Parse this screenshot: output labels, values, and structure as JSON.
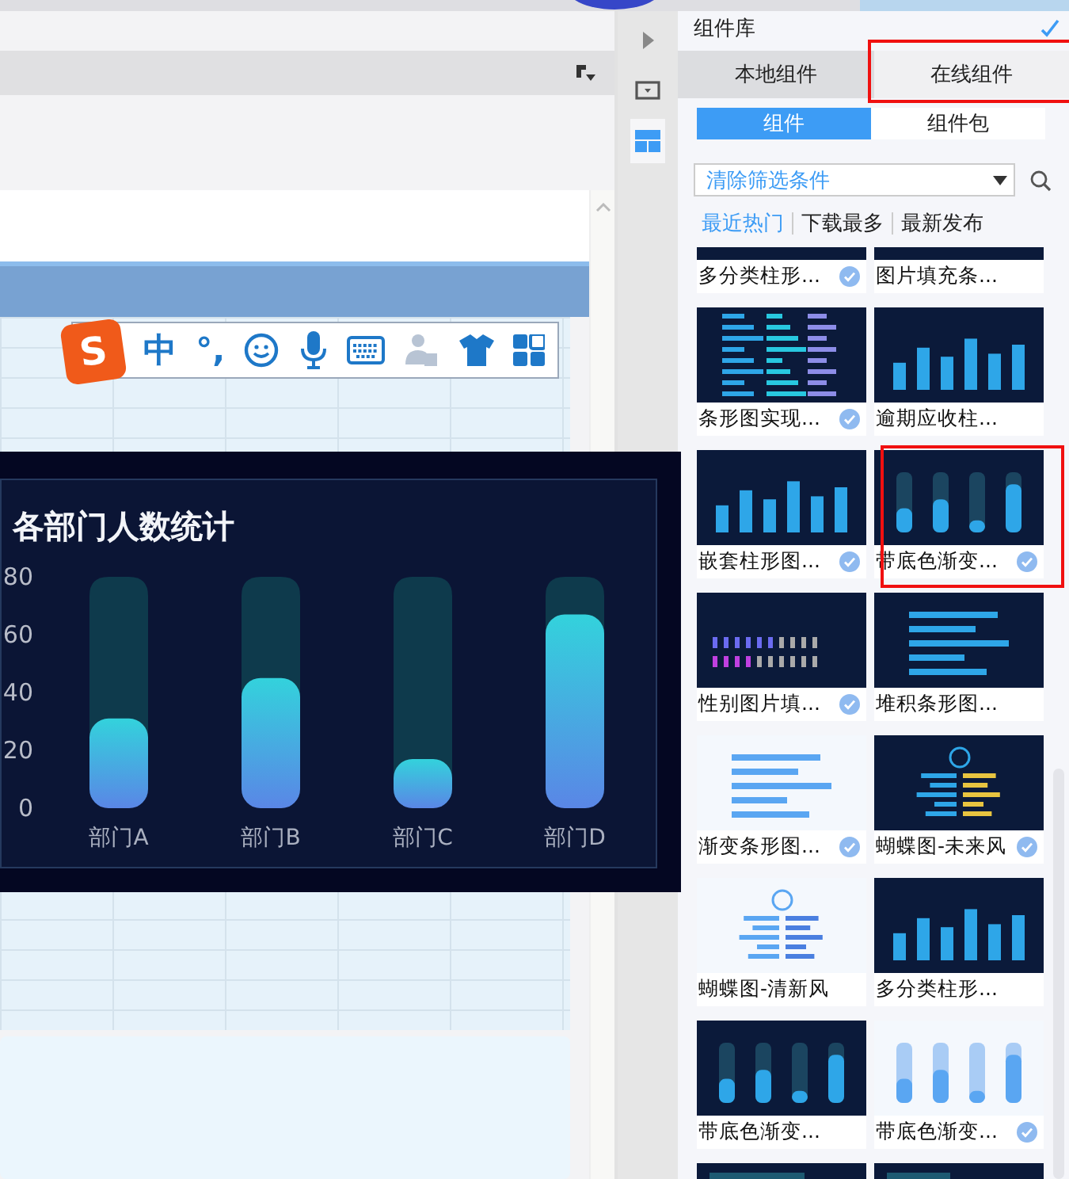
{
  "ime_bar": {
    "logo": "S",
    "mode": "中",
    "punctuation": "°,"
  },
  "chart": {
    "chart_data": {
      "type": "bar",
      "title": "各部门人数统计",
      "categories": [
        "部门A",
        "部门B",
        "部门C",
        "部门D"
      ],
      "values": [
        31,
        45,
        17,
        67
      ],
      "ylim": [
        0,
        80
      ],
      "yticks": [
        0,
        20,
        40,
        60,
        80
      ]
    }
  },
  "side_toolbar": [
    {
      "kind": "expand",
      "selected": false
    },
    {
      "kind": "dropdown",
      "selected": false
    },
    {
      "kind": "layout",
      "selected": true
    }
  ],
  "library": {
    "title": "组件库",
    "source_tabs": [
      {
        "label": "本地组件",
        "selected": false,
        "highlighted": false
      },
      {
        "label": "在线组件",
        "selected": true,
        "highlighted": true
      }
    ],
    "type_tabs": [
      {
        "label": "组件",
        "selected": true
      },
      {
        "label": "组件包",
        "selected": false
      }
    ],
    "filter": {
      "value": "清除筛选条件"
    },
    "sort_tabs": [
      {
        "label": "最近热门",
        "selected": true
      },
      {
        "label": "下载最多",
        "selected": false
      },
      {
        "label": "最新发布",
        "selected": false
      }
    ],
    "cards": [
      {
        "label": "多分类柱形...",
        "installed": true,
        "highlighted": false,
        "dark": true,
        "kind": "columns"
      },
      {
        "label": "图片填充条...",
        "installed": false,
        "highlighted": false,
        "dark": true,
        "kind": "rows"
      },
      {
        "label": "条形图实现...",
        "installed": true,
        "highlighted": false,
        "dark": true,
        "kind": "table"
      },
      {
        "label": "逾期应收柱...",
        "installed": false,
        "highlighted": false,
        "dark": true,
        "kind": "columns"
      },
      {
        "label": "嵌套柱形图...",
        "installed": true,
        "highlighted": false,
        "dark": true,
        "kind": "columns"
      },
      {
        "label": "带底色渐变...",
        "installed": true,
        "highlighted": true,
        "dark": true,
        "kind": "capsules"
      },
      {
        "label": "性别图片填...",
        "installed": true,
        "highlighted": false,
        "dark": true,
        "kind": "icons"
      },
      {
        "label": "堆积条形图...",
        "installed": false,
        "highlighted": false,
        "dark": true,
        "kind": "rows"
      },
      {
        "label": "渐变条形图...",
        "installed": true,
        "highlighted": false,
        "dark": false,
        "kind": "rows"
      },
      {
        "label": "蝴蝶图-未来风",
        "installed": true,
        "highlighted": false,
        "dark": true,
        "kind": "butterfly"
      },
      {
        "label": "蝴蝶图-清新风",
        "installed": false,
        "highlighted": false,
        "dark": false,
        "kind": "butterfly"
      },
      {
        "label": "多分类柱形...",
        "installed": false,
        "highlighted": false,
        "dark": true,
        "kind": "columns"
      },
      {
        "label": "带底色渐变...",
        "installed": false,
        "highlighted": false,
        "dark": true,
        "kind": "capsules"
      },
      {
        "label": "带底色渐变...",
        "installed": true,
        "highlighted": false,
        "dark": false,
        "kind": "capsules"
      }
    ],
    "more_cards": [
      {
        "dark": true,
        "kind": "rows"
      },
      {
        "dark": true,
        "kind": "columns"
      }
    ]
  }
}
